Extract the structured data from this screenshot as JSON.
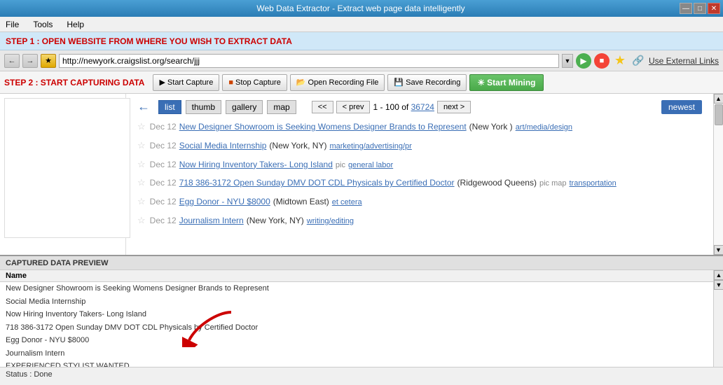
{
  "titleBar": {
    "title": "Web Data Extractor - Extract web page data intelligently",
    "minBtn": "—",
    "maxBtn": "□",
    "closeBtn": "✕"
  },
  "menuBar": {
    "items": [
      "File",
      "Tools",
      "Help"
    ]
  },
  "step1": {
    "label": "STEP 1 : OPEN WEBSITE FROM WHERE YOU WISH TO EXTRACT DATA"
  },
  "urlBar": {
    "url": "http://newyork.craigslist.org/search/jjj",
    "extLinksLabel": "Use External Links"
  },
  "step2": {
    "label": "STEP 2 : START CAPTURING DATA",
    "startCapture": "Start Capture",
    "stopCapture": "Stop Capture",
    "openRecording": "Open Recording File",
    "saveRecording": "Save Recording",
    "startMining": "Start Mining"
  },
  "navControls": {
    "views": [
      "list",
      "thumb",
      "gallery",
      "map"
    ],
    "activeView": "list",
    "prevBtn": "< prev",
    "nextBtn": "next >",
    "firstBtn": "<<",
    "pageStart": "1",
    "pageEnd": "100",
    "total": "36724",
    "newestBtn": "newest"
  },
  "listings": [
    {
      "date": "Dec 12",
      "title": "New Designer Showroom is Seeking Womens Designer Brands to Represent",
      "location": "(New York )",
      "tag": "art/media/design"
    },
    {
      "date": "Dec 12",
      "title": "Social Media Internship",
      "location": "(New York, NY)",
      "tag": "marketing/advertising/pr"
    },
    {
      "date": "Dec 12",
      "title": "Now Hiring Inventory Takers- Long Island",
      "location": "",
      "extras": "pic",
      "tag": "general labor"
    },
    {
      "date": "Dec 12",
      "title": "718 386-3172 Open Sunday DMV DOT CDL Physicals by Certified Doctor",
      "location": "(Ridgewood Queens)",
      "extras": "pic map",
      "tag": "transportation"
    },
    {
      "date": "Dec 12",
      "title": "Egg Donor - NYU $8000",
      "location": "(Midtown East)",
      "tag": "et cetera"
    },
    {
      "date": "Dec 12",
      "title": "Journalism Intern",
      "location": "(New York, NY)",
      "tag": "writing/editing"
    }
  ],
  "previewSection": {
    "header": "CAPTURED DATA PREVIEW",
    "columnName": "Name",
    "rows": [
      "New Designer Showroom is Seeking Womens Designer Brands to Represent",
      "Social Media Internship",
      "Now Hiring Inventory Takers- Long Island",
      "718 386-3172 Open Sunday DMV DOT CDL Physicals by Certified Doctor",
      "Egg Donor - NYU $8000",
      "Journalism Intern",
      "EXPERIENCED STYLIST WANTED"
    ]
  },
  "statusBar": {
    "label": "Status :",
    "status": "Done"
  }
}
